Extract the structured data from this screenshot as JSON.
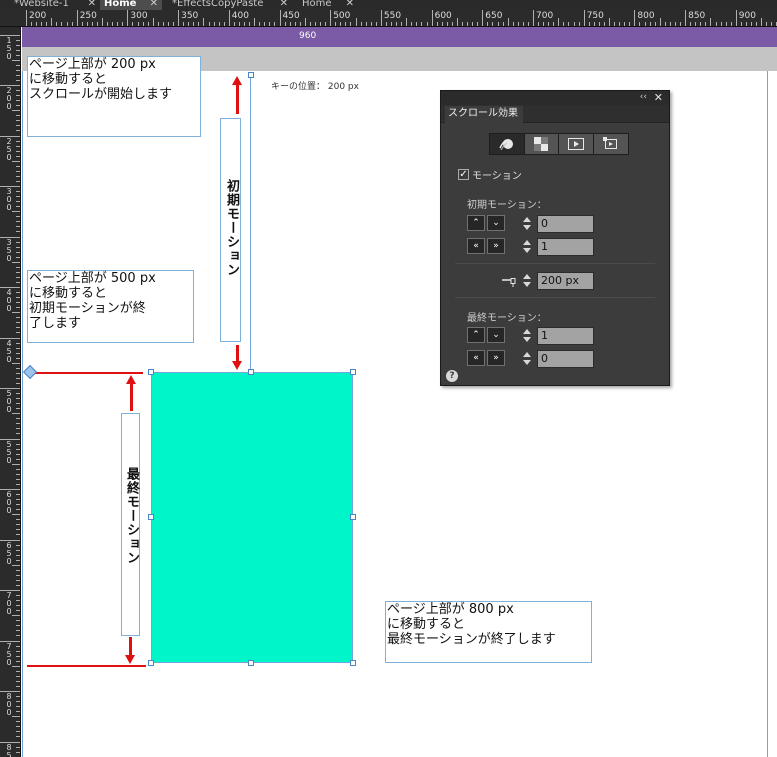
{
  "tabs": [
    {
      "label": "*Website-1",
      "active": false
    },
    {
      "label": "Home",
      "active": true
    },
    {
      "label": "*EffectsCopyPaste",
      "active": false
    },
    {
      "label": "Home",
      "active": false
    }
  ],
  "ruler": {
    "horizontal": [
      "200",
      "250",
      "300",
      "350",
      "400",
      "450",
      "500",
      "550",
      "600",
      "650",
      "700",
      "750",
      "800",
      "850",
      "900"
    ],
    "vertical": [
      "150",
      "200",
      "250",
      "300",
      "350",
      "400",
      "450",
      "500",
      "550",
      "600",
      "650",
      "700",
      "750",
      "800",
      "850"
    ]
  },
  "canvas": {
    "width_label": "960",
    "key_position": "キーの位置： 200 px",
    "initial_motion_label": "初期モーション",
    "final_motion_label": "最終モーション",
    "note_start": "ページ上部が 200 px\nに移動すると\nスクロールが開始します",
    "note_mid": "ページ上部が 500 px\nに移動すると\n初期モーションが終\n了します",
    "note_end": "ページ上部が 800 px\nに移動すると\n最終モーションが終了します",
    "element_color": "#00f5c8"
  },
  "panel": {
    "title": "スクロール効果",
    "collapse": "‹‹",
    "close": "✕",
    "icons": [
      "motion-icon",
      "fade-icon",
      "slideshow-icon",
      "adjust-icon"
    ],
    "motion_label": "モーション",
    "motion_checked": true,
    "initial_section": "初期モーション：",
    "initial_vertical_value": "0",
    "initial_horizontal_value": "1",
    "key_value": "200 px",
    "final_section": "最終モーション：",
    "final_vertical_value": "1",
    "final_horizontal_value": "0",
    "help": "?"
  }
}
